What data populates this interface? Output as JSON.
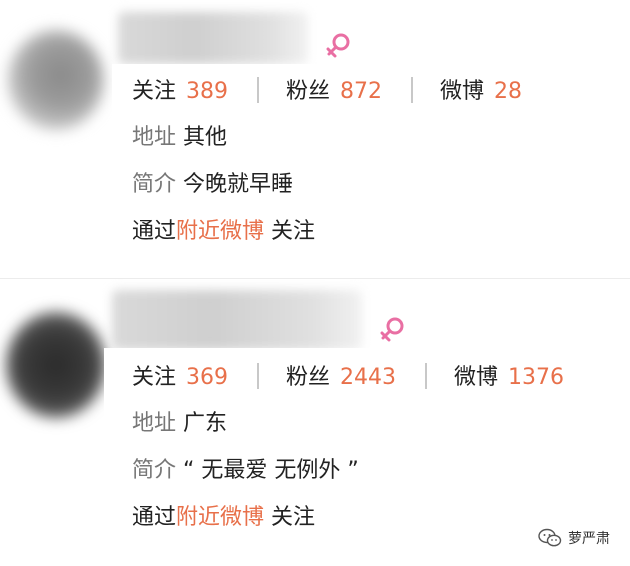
{
  "colors": {
    "accent": "#e8704a",
    "label": "#777777",
    "text": "#222222",
    "female": "#e96fa3"
  },
  "users": [
    {
      "gender_icon": "female-icon",
      "stats": [
        {
          "label": "关注",
          "value": "389"
        },
        {
          "label": "粉丝",
          "value": "872"
        },
        {
          "label": "微博",
          "value": "28"
        }
      ],
      "address_label": "地址",
      "address": "其他",
      "bio_label": "简介",
      "bio": "今晚就早睡",
      "via_prefix": "通过",
      "via_link": "附近微博",
      "via_suffix": "关注"
    },
    {
      "gender_icon": "female-icon",
      "stats": [
        {
          "label": "关注",
          "value": "369"
        },
        {
          "label": "粉丝",
          "value": "2443"
        },
        {
          "label": "微博",
          "value": "1376"
        }
      ],
      "address_label": "地址",
      "address": "广东",
      "bio_label": "简介",
      "bio": "“ 无最爱 无例外 ”",
      "via_prefix": "通过",
      "via_link": "附近微博",
      "via_suffix": "关注"
    }
  ],
  "watermark": {
    "icon": "wechat-logo-icon",
    "text": "萝严肃"
  }
}
